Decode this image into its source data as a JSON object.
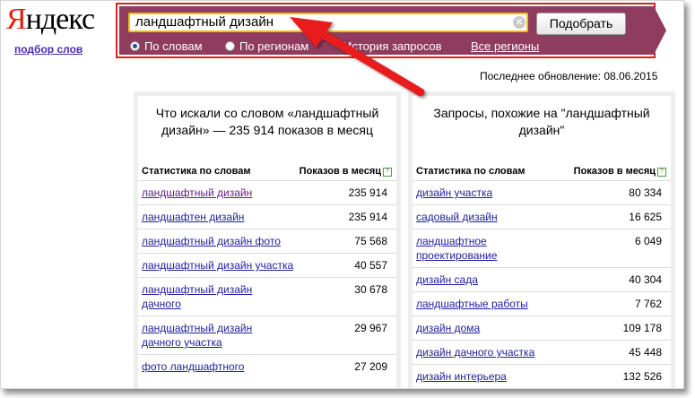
{
  "logo": {
    "first_letter": "Я",
    "rest": "ндекс"
  },
  "subtitle_link": "подбор слов",
  "search": {
    "query": "ландшафтный дизайн",
    "clear_icon": "close-icon",
    "submit_label": "Подобрать",
    "radio_by_words": "По словам",
    "radio_by_regions": "По регионам",
    "history_link": "История запросов",
    "regions_link": "Все регионы"
  },
  "last_update": "Последнее обновление: 08.06.2015",
  "left_column": {
    "title": "Что искали со словом «ландшафтный дизайн» — 235 914 показов в месяц",
    "col_words": "Статистика по словам",
    "col_count": "Показов в месяц",
    "rows": [
      {
        "keyword": "ландшафтный дизайн",
        "count": "235 914"
      },
      {
        "keyword": "ландшафтен дизайн",
        "count": "235 914"
      },
      {
        "keyword": "ландшафтный дизайн фото",
        "count": "75 568"
      },
      {
        "keyword": "ландшафтный дизайн участка",
        "count": "40 557"
      },
      {
        "keyword": "ландшафтный дизайн дачного",
        "count": "30 678"
      },
      {
        "keyword": "ландшафтный дизайн дачного участка",
        "count": "29 967"
      },
      {
        "keyword": "фото ландшафтного",
        "count": "27 209"
      }
    ]
  },
  "right_column": {
    "title": "Запросы, похожие на \"ландшафтный дизайн\"",
    "col_words": "Статистика по словам",
    "col_count": "Показов в месяц",
    "rows": [
      {
        "keyword": "дизайн участка",
        "count": "80 334"
      },
      {
        "keyword": "садовый дизайн",
        "count": "16 625"
      },
      {
        "keyword": "ландшафтное проектирование",
        "count": "6 049"
      },
      {
        "keyword": "дизайн сада",
        "count": "40 304"
      },
      {
        "keyword": "ландшафтные работы",
        "count": "7 762"
      },
      {
        "keyword": "дизайн дома",
        "count": "109 178"
      },
      {
        "keyword": "дизайн дачного участка",
        "count": "45 448"
      },
      {
        "keyword": "дизайн интерьера",
        "count": "132 526"
      }
    ]
  },
  "colors": {
    "panel": "#8f3c5e",
    "highlight_border": "#e02020",
    "arrow": "#e81c1c",
    "link": "#2020a0",
    "visited_link": "#6a1a8a"
  }
}
